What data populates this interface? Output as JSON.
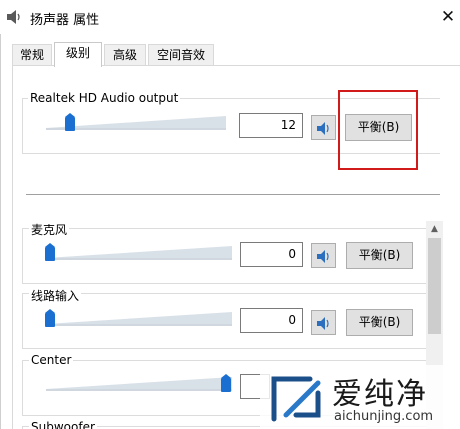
{
  "window": {
    "title": "扬声器 属性",
    "close_glyph": "✕"
  },
  "tabs": [
    {
      "label": "常规",
      "active": false
    },
    {
      "label": "级别",
      "active": true
    },
    {
      "label": "高级",
      "active": false
    },
    {
      "label": "空间音效",
      "active": false
    }
  ],
  "main_output": {
    "label": "Realtek HD Audio output",
    "volume": "12",
    "level_percent": 12,
    "balance_label": "平衡(B)",
    "speaker_icon": "speaker-icon"
  },
  "channels": [
    {
      "label": "麦克风",
      "volume": "0",
      "level_percent": 0,
      "balance_label": "平衡(B)",
      "speaker_icon": "speaker-icon"
    },
    {
      "label": "线路输入",
      "volume": "0",
      "level_percent": 0,
      "balance_label": "平衡(B)",
      "speaker_icon": "speaker-icon"
    },
    {
      "label": "Center",
      "volume": "",
      "level_percent": 100,
      "balance_label": "",
      "speaker_icon": ""
    },
    {
      "label": "Subwoofer",
      "volume": "",
      "level_percent": null,
      "balance_label": "",
      "speaker_icon": ""
    }
  ],
  "watermark": {
    "brand": "爱纯净",
    "url": "aichunjing.com"
  },
  "colors": {
    "accent_blue": "#1b6fd1",
    "highlight_red": "#d11a1a"
  }
}
